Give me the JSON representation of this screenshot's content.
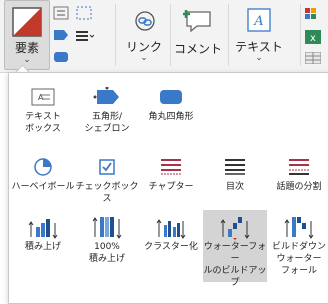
{
  "ribbon": {
    "elements_label": "要素",
    "link_label": "リンク",
    "comment_label": "コメント",
    "text_label": "テキスト"
  },
  "dropdown": {
    "items": [
      {
        "label": "テキスト\nボックス",
        "icon": "text-box-icon"
      },
      {
        "label": "五角形/\nシェブロン",
        "icon": "pentagon-chevron-icon"
      },
      {
        "label": "角丸四角形",
        "icon": "rounded-rectangle-icon"
      },
      {
        "label": "ハーベイボール",
        "icon": "harvey-ball-icon"
      },
      {
        "label": "チェックボックス",
        "icon": "checkbox-icon"
      },
      {
        "label": "チャプター",
        "icon": "chapter-icon"
      },
      {
        "label": "目次",
        "icon": "table-of-contents-icon"
      },
      {
        "label": "話題の分割",
        "icon": "topic-split-icon"
      },
      {
        "label": "積み上げ",
        "icon": "stacked-chart-icon"
      },
      {
        "label": "100%\n積み上げ",
        "icon": "stacked-100-chart-icon"
      },
      {
        "label": "クラスター化",
        "icon": "clustered-chart-icon"
      },
      {
        "label": "ウォーターフォー\nルのビルドアップ",
        "icon": "waterfall-buildup-icon"
      },
      {
        "label": "ビルドダウン\nウォーター\nフォール",
        "icon": "waterfall-builddown-icon"
      }
    ]
  },
  "colors": {
    "accent_blue": "#3a78c8",
    "accent_red": "#c0392b",
    "accent_green": "#2e8b57",
    "chapter_red": "#a8324a"
  }
}
